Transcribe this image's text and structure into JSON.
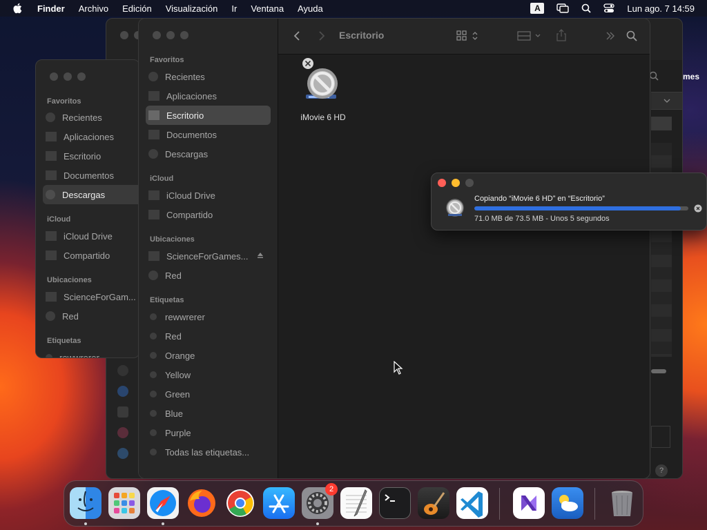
{
  "menubar": {
    "items": [
      "Finder",
      "Archivo",
      "Edición",
      "Visualización",
      "Ir",
      "Ventana",
      "Ayuda"
    ],
    "input_indicator": "A",
    "clock": "Lun ago. 7  14:59"
  },
  "left_window": {
    "sections": [
      {
        "title": "Favoritos",
        "items": [
          "Recientes",
          "Aplicaciones",
          "Escritorio",
          "Documentos",
          "Descargas"
        ]
      },
      {
        "title": "iCloud",
        "items": [
          "iCloud Drive",
          "Compartido"
        ]
      },
      {
        "title": "Ubicaciones",
        "items": [
          "ScienceForGam...",
          "Red"
        ]
      },
      {
        "title": "Etiquetas",
        "items": [
          "rewwrerer"
        ]
      }
    ],
    "selected": "Descargas"
  },
  "main_window": {
    "title": "Escritorio",
    "sidebar": {
      "sections": [
        {
          "title": "Favoritos",
          "items": [
            "Recientes",
            "Aplicaciones",
            "Escritorio",
            "Documentos",
            "Descargas"
          ]
        },
        {
          "title": "iCloud",
          "items": [
            "iCloud Drive",
            "Compartido"
          ]
        },
        {
          "title": "Ubicaciones",
          "items": [
            "ScienceForGames...",
            "Red"
          ]
        },
        {
          "title": "Etiquetas",
          "items": [
            "rewwrerer",
            "Red",
            "Orange",
            "Yellow",
            "Green",
            "Blue",
            "Purple",
            "Todas las etiquetas..."
          ]
        }
      ],
      "selected": "Escritorio"
    },
    "files": [
      {
        "name": "iMovie 6 HD"
      }
    ]
  },
  "back_window": {
    "partial_text": "mes"
  },
  "copy_dialog": {
    "title": "Copiando “iMovie 6 HD” en “Escritorio”",
    "status": "71.0 MB de 73.5 MB - Unos 5 segundos",
    "progress": 0.966
  },
  "dock": {
    "apps": [
      {
        "name": "finder-icon",
        "running": true
      },
      {
        "name": "launchpad-icon",
        "running": false
      },
      {
        "name": "safari-icon",
        "running": true
      },
      {
        "name": "firefox-icon",
        "running": false
      },
      {
        "name": "chrome-icon",
        "running": false
      },
      {
        "name": "app-store-icon",
        "running": false
      },
      {
        "name": "system-settings-icon",
        "running": true,
        "badge": "2"
      },
      {
        "name": "textedit-icon",
        "running": false
      },
      {
        "name": "terminal-icon",
        "running": false
      },
      {
        "name": "garageband-icon",
        "running": false
      },
      {
        "name": "vscode-icon",
        "running": false
      },
      {
        "name": "visual-studio-icon",
        "running": false
      },
      {
        "name": "weather-icon",
        "running": false
      },
      {
        "name": "trash-icon",
        "running": false
      }
    ]
  }
}
